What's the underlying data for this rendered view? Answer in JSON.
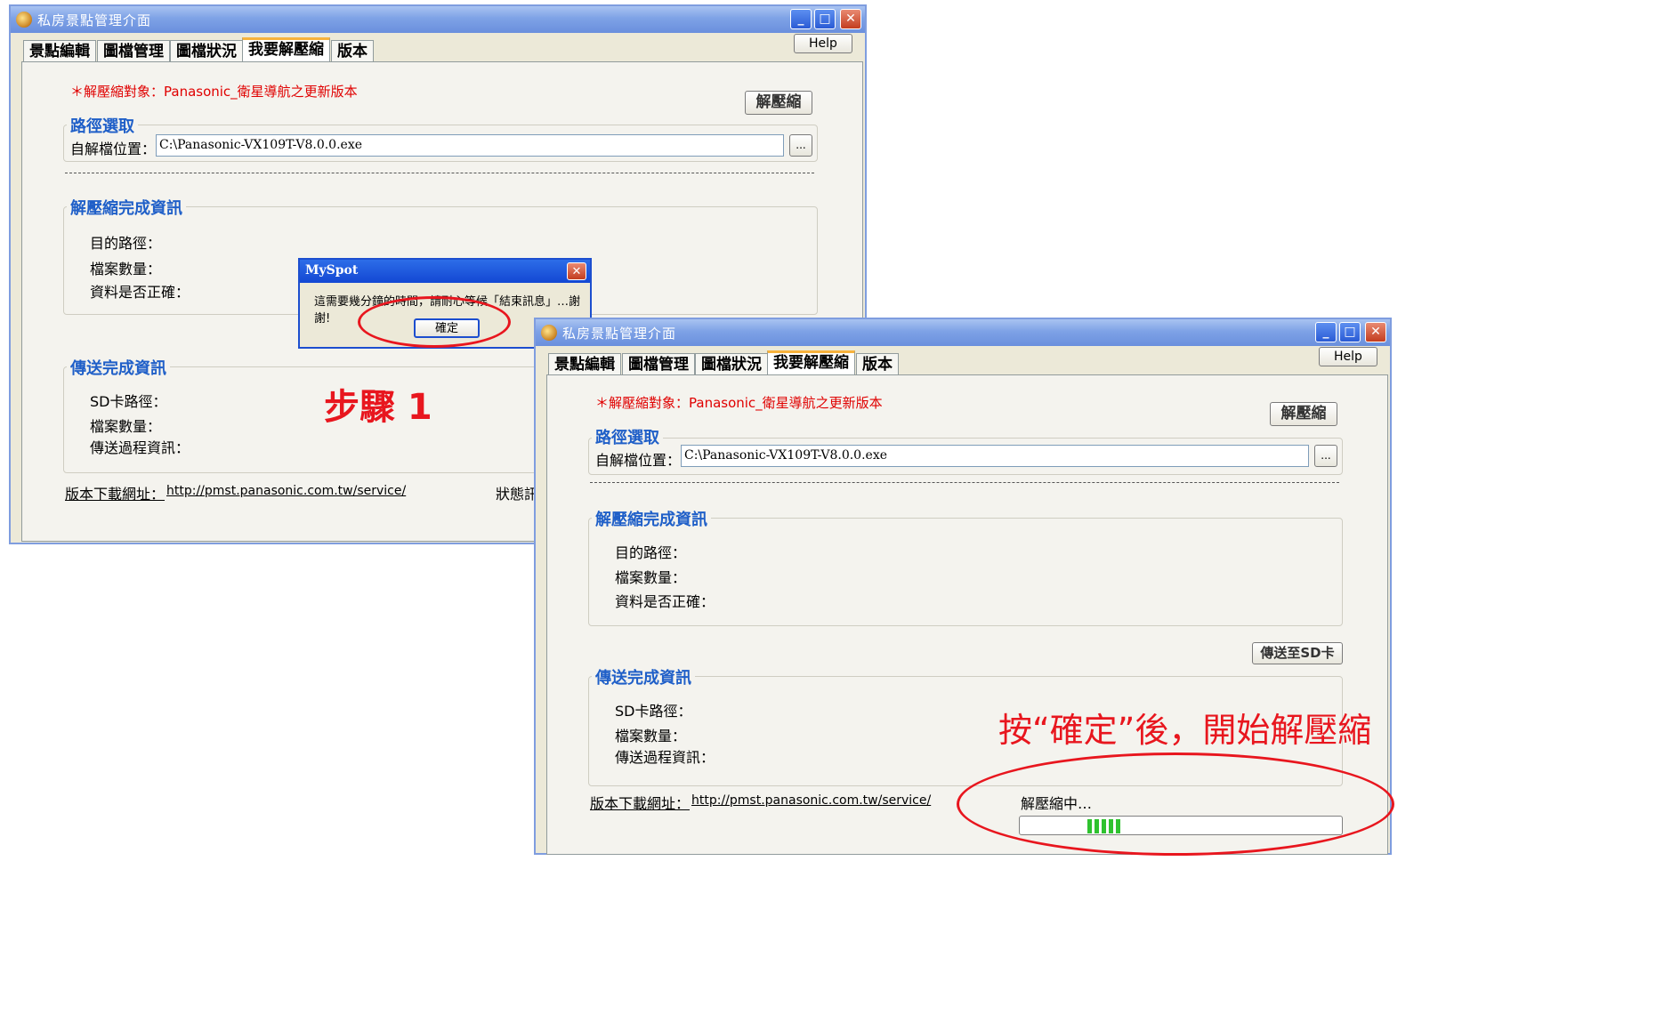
{
  "window1": {
    "title": "私房景點管理介面",
    "tabs": [
      "景點編輯",
      "圖檔管理",
      "圖檔狀況",
      "我要解壓縮",
      "版本"
    ],
    "help_label": "Help",
    "warning": "＊解壓縮對象：Panasonic_衛星導航之更新版本",
    "decompress_button": "解壓縮",
    "path_group_title": "路徑選取",
    "self_extract_label": "自解檔位置：",
    "self_extract_value": "C:\\Panasonic-VX109T-V8.0.0.exe",
    "browse_label": "...",
    "decompress_info_title": "解壓縮完成資訊",
    "dest_path_label": "目的路徑：",
    "file_count_label": "檔案數量：",
    "data_correct_label": "資料是否正確：",
    "transfer_info_title": "傳送完成資訊",
    "sd_path_label": "SD卡路徑：",
    "transfer_count_label": "檔案數量：",
    "transfer_progress_label": "傳送過程資訊：",
    "download_label": "版本下載網址：",
    "download_url": "http://pmst.panasonic.com.tw/service/",
    "status_label": "狀態訊"
  },
  "dialog": {
    "title": "MySpot",
    "message": "這需要幾分鐘的時間，請耐心等候「結束訊息」…謝謝!",
    "ok_label": "確定"
  },
  "window2": {
    "title": "私房景點管理介面",
    "tabs": [
      "景點編輯",
      "圖檔管理",
      "圖檔狀況",
      "我要解壓縮",
      "版本"
    ],
    "help_label": "Help",
    "warning": "＊解壓縮對象：Panasonic_衛星導航之更新版本",
    "decompress_button": "解壓縮",
    "path_group_title": "路徑選取",
    "self_extract_label": "自解檔位置：",
    "self_extract_value": "C:\\Panasonic-VX109T-V8.0.0.exe",
    "browse_label": "...",
    "decompress_info_title": "解壓縮完成資訊",
    "dest_path_label": "目的路徑：",
    "file_count_label": "檔案數量：",
    "data_correct_label": "資料是否正確：",
    "send_sd_button": "傳送至SD卡",
    "transfer_info_title": "傳送完成資訊",
    "sd_path_label": "SD卡路徑：",
    "transfer_count_label": "檔案數量：",
    "transfer_progress_label": "傳送過程資訊：",
    "download_label": "版本下載網址：",
    "download_url": "http://pmst.panasonic.com.tw/service/",
    "status_text": "解壓縮中…"
  },
  "annotations": {
    "step1": "步驟 1",
    "after_ok": "按“確定”後，開始解壓縮"
  },
  "colors": {
    "annotation_red": "#e8161e",
    "group_title_blue": "#1f5fc8",
    "progress_green": "#2fc22f"
  }
}
